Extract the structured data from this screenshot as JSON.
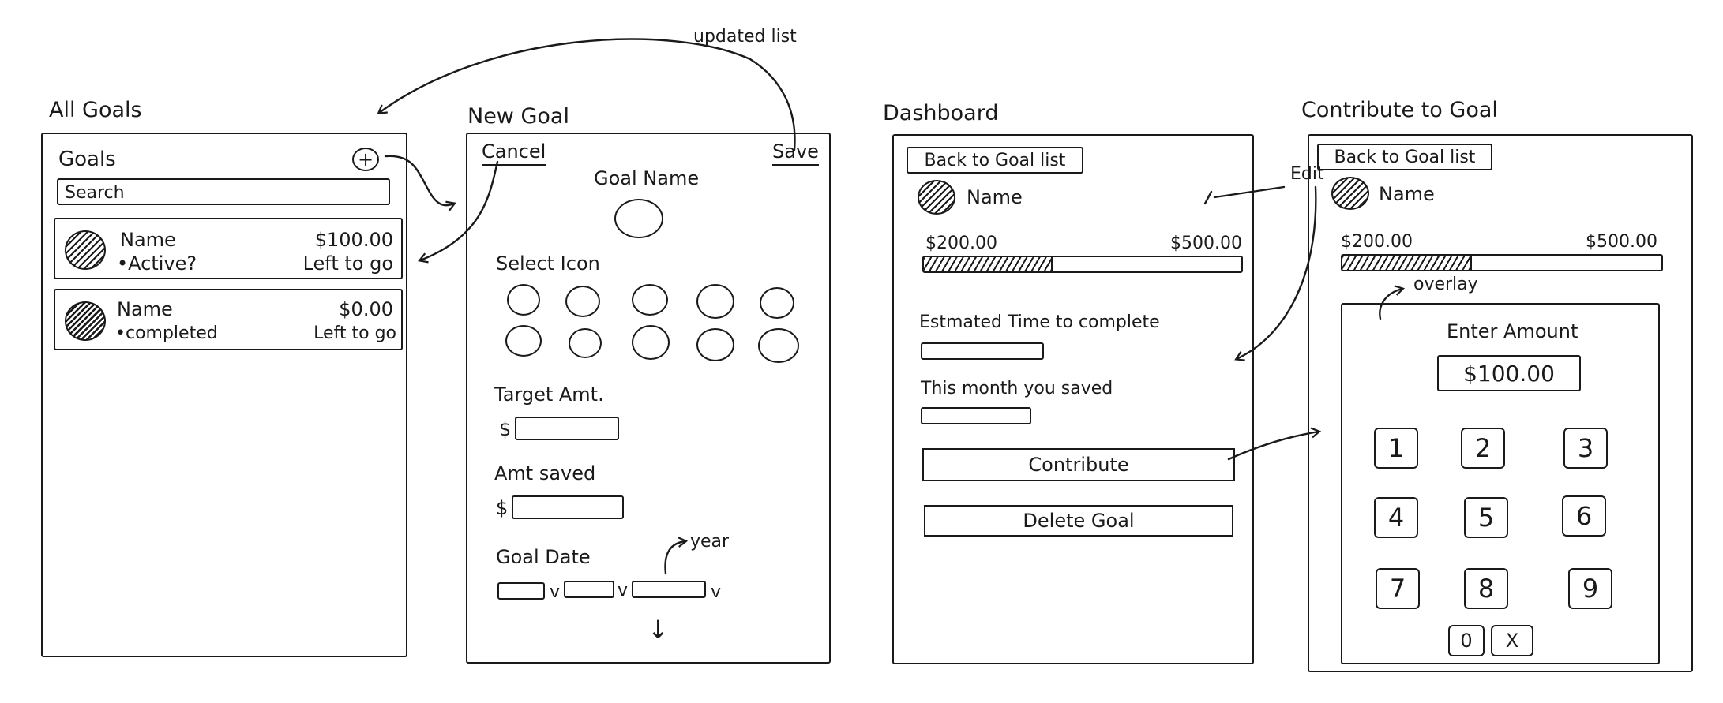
{
  "annotations": {
    "updated_list": "updated list",
    "edit": "Edit",
    "overlay": "overlay",
    "year": "year"
  },
  "all_goals": {
    "screen_title": "All Goals",
    "header": "Goals",
    "add_icon": "plus-circle-icon",
    "add_symbol": "+",
    "search_placeholder": "Search",
    "goals": [
      {
        "name": "Name",
        "status": "•Active?",
        "amount": "$100.00",
        "note": "Left to go",
        "icon": "hatched-circle-icon"
      },
      {
        "name": "Name",
        "status": "•completed",
        "amount": "$0.00",
        "note": "Left to go",
        "icon": "hatched-circle-icon"
      }
    ]
  },
  "new_goal": {
    "screen_title": "New Goal",
    "cancel_label": "Cancel",
    "save_label": "Save",
    "goal_name_label": "Goal Name",
    "select_icon_label": "Select Icon",
    "target_label": "Target Amt.",
    "saved_label": "Amt saved",
    "currency_symbol": "$",
    "date_label": "Goal Date",
    "dropdown_marker": "v",
    "scroll_icon": "down-arrow-icon",
    "scroll_symbol": "↓"
  },
  "dashboard": {
    "screen_title": "Dashboard",
    "back_label": "Back to Goal list",
    "goal_name": "Name",
    "saved_amount": "$200.00",
    "target_amount": "$500.00",
    "progress_fraction": 0.4,
    "time_label": "Estmated Time to complete",
    "month_label": "This month you saved",
    "contribute_label": "Contribute",
    "delete_label": "Delete Goal"
  },
  "contribute": {
    "screen_title": "Contribute to Goal",
    "back_label": "Back to Goal list",
    "goal_name": "Name",
    "saved_amount": "$200.00",
    "target_amount": "$500.00",
    "progress_fraction": 0.4,
    "enter_label": "Enter Amount",
    "amount_value": "$100.00",
    "keys": [
      "1",
      "2",
      "3",
      "4",
      "5",
      "6",
      "7",
      "8",
      "9"
    ],
    "zero_key": "0",
    "clear_key": "X"
  }
}
